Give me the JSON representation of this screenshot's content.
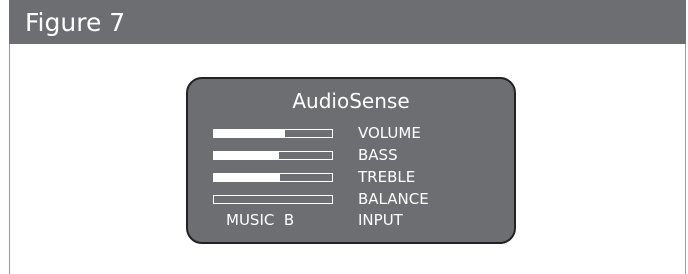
{
  "colors": {
    "header_bg": "#6d6e71",
    "screen_bg": "#6d6e71",
    "text": "#ffffff",
    "border": "#9a9a9a"
  },
  "figure": {
    "title": "Figure 7"
  },
  "screen": {
    "title": "AudioSense",
    "settings": [
      {
        "label": "VOLUME",
        "level": 0.6
      },
      {
        "label": "BASS",
        "level": 0.55
      },
      {
        "label": "TREBLE",
        "level": 0.56
      },
      {
        "label": "BALANCE",
        "level": 0.0
      }
    ],
    "input": {
      "label": "INPUT",
      "value": "MUSIC  B"
    }
  }
}
